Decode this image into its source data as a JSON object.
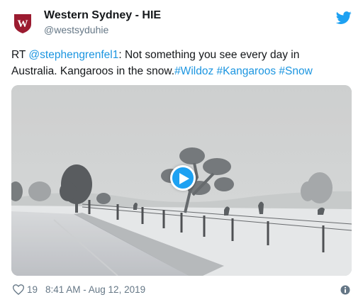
{
  "account": {
    "name": "Western Sydney - HIE",
    "handle": "@westsyduhie",
    "logo_letter": "W",
    "logo_color": "#9b1b30"
  },
  "tweet": {
    "prefix": "RT ",
    "mention": "@stephengrenfel1",
    "body": ": Not something you see every day in Australia. Kangaroos in the snow.",
    "hashtags": [
      "#Wildoz",
      "#Kangaroos",
      "#Snow"
    ]
  },
  "media": {
    "type": "video",
    "play_icon": "play-icon"
  },
  "footer": {
    "like_count": "19",
    "timestamp": "8:41 AM - Aug 12, 2019",
    "info_icon": "info-icon"
  },
  "colors": {
    "link": "#1b95e0",
    "accent": "#1da1f2",
    "muted": "#657786",
    "text": "#14171a"
  }
}
